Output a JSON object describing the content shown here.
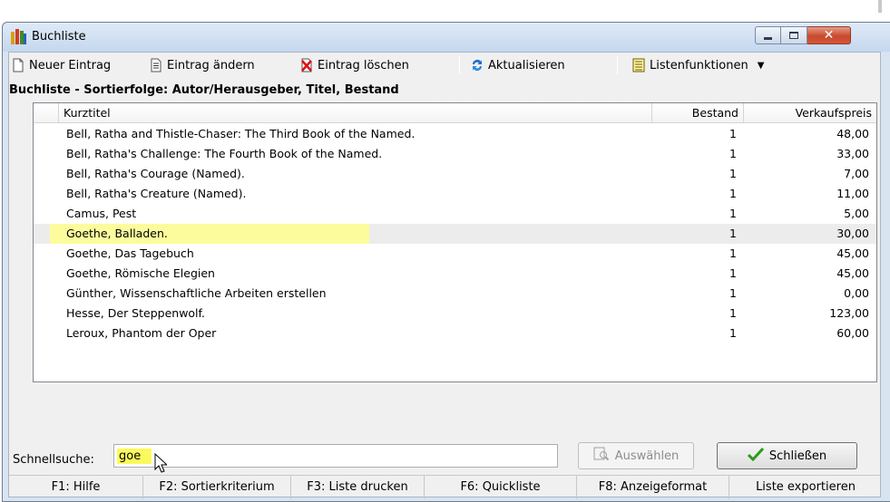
{
  "window": {
    "title": "Buchliste"
  },
  "toolbar": {
    "new_entry": "Neuer Eintrag",
    "edit_entry": "Eintrag ändern",
    "delete_entry": "Eintrag löschen",
    "refresh": "Aktualisieren",
    "list_functions": "Listenfunktionen"
  },
  "list": {
    "caption": "Buchliste - Sortierfolge: Autor/Herausgeber, Titel, Bestand",
    "columns": {
      "title": "Kurztitel",
      "qty": "Bestand",
      "price": "Verkaufspreis"
    },
    "rows": [
      {
        "title": "Bell, Ratha and Thistle-Chaser: The Third Book of the Named.",
        "qty": "1",
        "price": "48,00"
      },
      {
        "title": "Bell, Ratha's Challenge: The Fourth Book of the Named.",
        "qty": "1",
        "price": "33,00"
      },
      {
        "title": "Bell, Ratha's Courage (Named).",
        "qty": "1",
        "price": "7,00"
      },
      {
        "title": "Bell, Ratha's Creature (Named).",
        "qty": "1",
        "price": "11,00"
      },
      {
        "title": "Camus, Pest",
        "qty": "1",
        "price": "5,00"
      },
      {
        "title": "Goethe, Balladen.",
        "qty": "1",
        "price": "30,00"
      },
      {
        "title": "Goethe, Das Tagebuch",
        "qty": "1",
        "price": "45,00"
      },
      {
        "title": "Goethe, Römische Elegien",
        "qty": "1",
        "price": "45,00"
      },
      {
        "title": "Günther, Wissenschaftliche Arbeiten erstellen",
        "qty": "1",
        "price": "0,00"
      },
      {
        "title": "Hesse, Der Steppenwolf.",
        "qty": "1",
        "price": "123,00"
      },
      {
        "title": "Leroux, Phantom der Oper",
        "qty": "1",
        "price": "60,00"
      }
    ],
    "selected_index": 5
  },
  "search": {
    "label": "Schnellsuche:",
    "value": "goe"
  },
  "buttons": {
    "select": "Auswählen",
    "close": "Schließen"
  },
  "statusbar": {
    "f1": "F1: Hilfe",
    "f2": "F2: Sortierkriterium",
    "f3": "F3: Liste drucken",
    "f6": "F6: Quickliste",
    "f8": "F8: Anzeigeformat",
    "export": "Liste exportieren"
  },
  "colors": {
    "highlight": "#fcfc9d",
    "search_highlight": "#fafa5c",
    "titlebar": "#c5d7ee"
  }
}
